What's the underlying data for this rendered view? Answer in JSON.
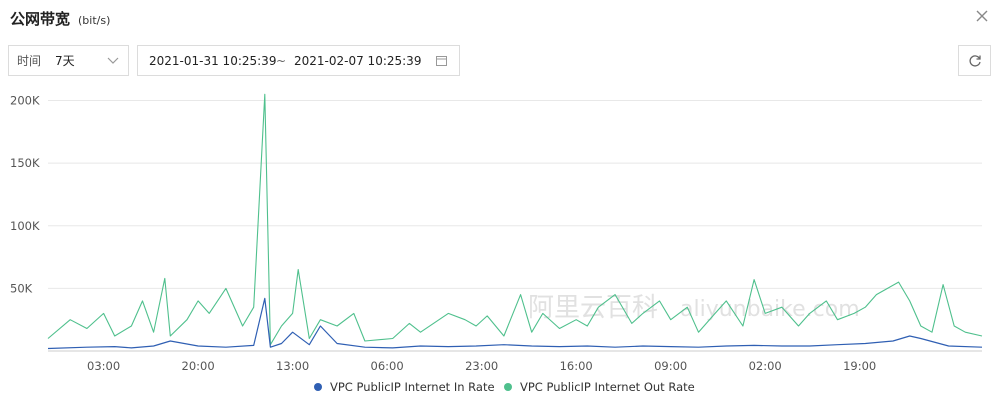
{
  "header": {
    "title": "公网带宽",
    "unit": "(bit/s)"
  },
  "toolbar": {
    "range_label": "时间",
    "range_value": "7天",
    "start_time": "2021-01-31 10:25:39",
    "separator": "~",
    "end_time": "2021-02-07 10:25:39"
  },
  "icons": {
    "close": "close-icon",
    "chevron": "chevron-down-icon",
    "calendar": "calendar-icon",
    "refresh": "refresh-icon"
  },
  "watermark": {
    "text": "阿里云百科",
    "suffix": "aliyunbaike.com"
  },
  "chart_data": {
    "type": "line",
    "ylim": [
      0,
      210000
    ],
    "y_ticks": [
      {
        "value": 200000,
        "label": "200K"
      },
      {
        "value": 150000,
        "label": "150K"
      },
      {
        "value": 100000,
        "label": "100K"
      },
      {
        "value": 50000,
        "label": "50K"
      }
    ],
    "x_ticks": [
      "03:00",
      "20:00",
      "13:00",
      "06:00",
      "23:00",
      "16:00",
      "09:00",
      "02:00",
      "19:00"
    ],
    "x_tick_positions": [
      3,
      20,
      37,
      54,
      71,
      88,
      105,
      122,
      139
    ],
    "x_range": [
      -7,
      161
    ],
    "grid": true,
    "legend_position": "bottom",
    "series": [
      {
        "name": "VPC PublicIP Internet In Rate",
        "color": "#2f5fb3",
        "points": [
          [
            -7,
            2000
          ],
          [
            0,
            3000
          ],
          [
            5,
            3500
          ],
          [
            8,
            2500
          ],
          [
            12,
            4000
          ],
          [
            15,
            8000
          ],
          [
            20,
            4000
          ],
          [
            25,
            3000
          ],
          [
            30,
            4500
          ],
          [
            32,
            42000
          ],
          [
            33,
            3000
          ],
          [
            35,
            6000
          ],
          [
            37,
            15000
          ],
          [
            40,
            5000
          ],
          [
            42,
            20000
          ],
          [
            45,
            6000
          ],
          [
            50,
            3000
          ],
          [
            55,
            2500
          ],
          [
            60,
            4000
          ],
          [
            65,
            3500
          ],
          [
            70,
            4000
          ],
          [
            75,
            5000
          ],
          [
            80,
            4000
          ],
          [
            85,
            3500
          ],
          [
            90,
            4000
          ],
          [
            95,
            3000
          ],
          [
            100,
            4000
          ],
          [
            105,
            3500
          ],
          [
            110,
            3000
          ],
          [
            115,
            4000
          ],
          [
            120,
            4500
          ],
          [
            125,
            4000
          ],
          [
            130,
            4000
          ],
          [
            135,
            5000
          ],
          [
            140,
            6000
          ],
          [
            145,
            8000
          ],
          [
            148,
            12000
          ],
          [
            150,
            10000
          ],
          [
            155,
            4000
          ],
          [
            161,
            3000
          ]
        ]
      },
      {
        "name": "VPC PublicIP Internet Out Rate",
        "color": "#4fc08d",
        "points": [
          [
            -7,
            10000
          ],
          [
            -3,
            25000
          ],
          [
            0,
            18000
          ],
          [
            3,
            30000
          ],
          [
            5,
            12000
          ],
          [
            8,
            20000
          ],
          [
            10,
            40000
          ],
          [
            12,
            15000
          ],
          [
            14,
            58000
          ],
          [
            15,
            12000
          ],
          [
            18,
            25000
          ],
          [
            20,
            40000
          ],
          [
            22,
            30000
          ],
          [
            25,
            50000
          ],
          [
            28,
            20000
          ],
          [
            30,
            35000
          ],
          [
            32,
            205000
          ],
          [
            33,
            5000
          ],
          [
            35,
            20000
          ],
          [
            37,
            30000
          ],
          [
            38,
            65000
          ],
          [
            40,
            10000
          ],
          [
            42,
            25000
          ],
          [
            45,
            20000
          ],
          [
            48,
            30000
          ],
          [
            50,
            8000
          ],
          [
            55,
            10000
          ],
          [
            58,
            22000
          ],
          [
            60,
            15000
          ],
          [
            65,
            30000
          ],
          [
            68,
            25000
          ],
          [
            70,
            20000
          ],
          [
            72,
            28000
          ],
          [
            75,
            12000
          ],
          [
            78,
            45000
          ],
          [
            80,
            15000
          ],
          [
            82,
            30000
          ],
          [
            85,
            18000
          ],
          [
            88,
            25000
          ],
          [
            90,
            20000
          ],
          [
            92,
            35000
          ],
          [
            95,
            45000
          ],
          [
            98,
            22000
          ],
          [
            100,
            30000
          ],
          [
            103,
            40000
          ],
          [
            105,
            25000
          ],
          [
            108,
            35000
          ],
          [
            110,
            15000
          ],
          [
            113,
            30000
          ],
          [
            115,
            40000
          ],
          [
            118,
            20000
          ],
          [
            120,
            57000
          ],
          [
            122,
            30000
          ],
          [
            125,
            35000
          ],
          [
            128,
            20000
          ],
          [
            130,
            30000
          ],
          [
            133,
            40000
          ],
          [
            135,
            25000
          ],
          [
            138,
            30000
          ],
          [
            140,
            35000
          ],
          [
            142,
            45000
          ],
          [
            144,
            50000
          ],
          [
            146,
            55000
          ],
          [
            148,
            40000
          ],
          [
            150,
            20000
          ],
          [
            152,
            15000
          ],
          [
            154,
            53000
          ],
          [
            156,
            20000
          ],
          [
            158,
            15000
          ],
          [
            161,
            12000
          ]
        ]
      }
    ]
  }
}
